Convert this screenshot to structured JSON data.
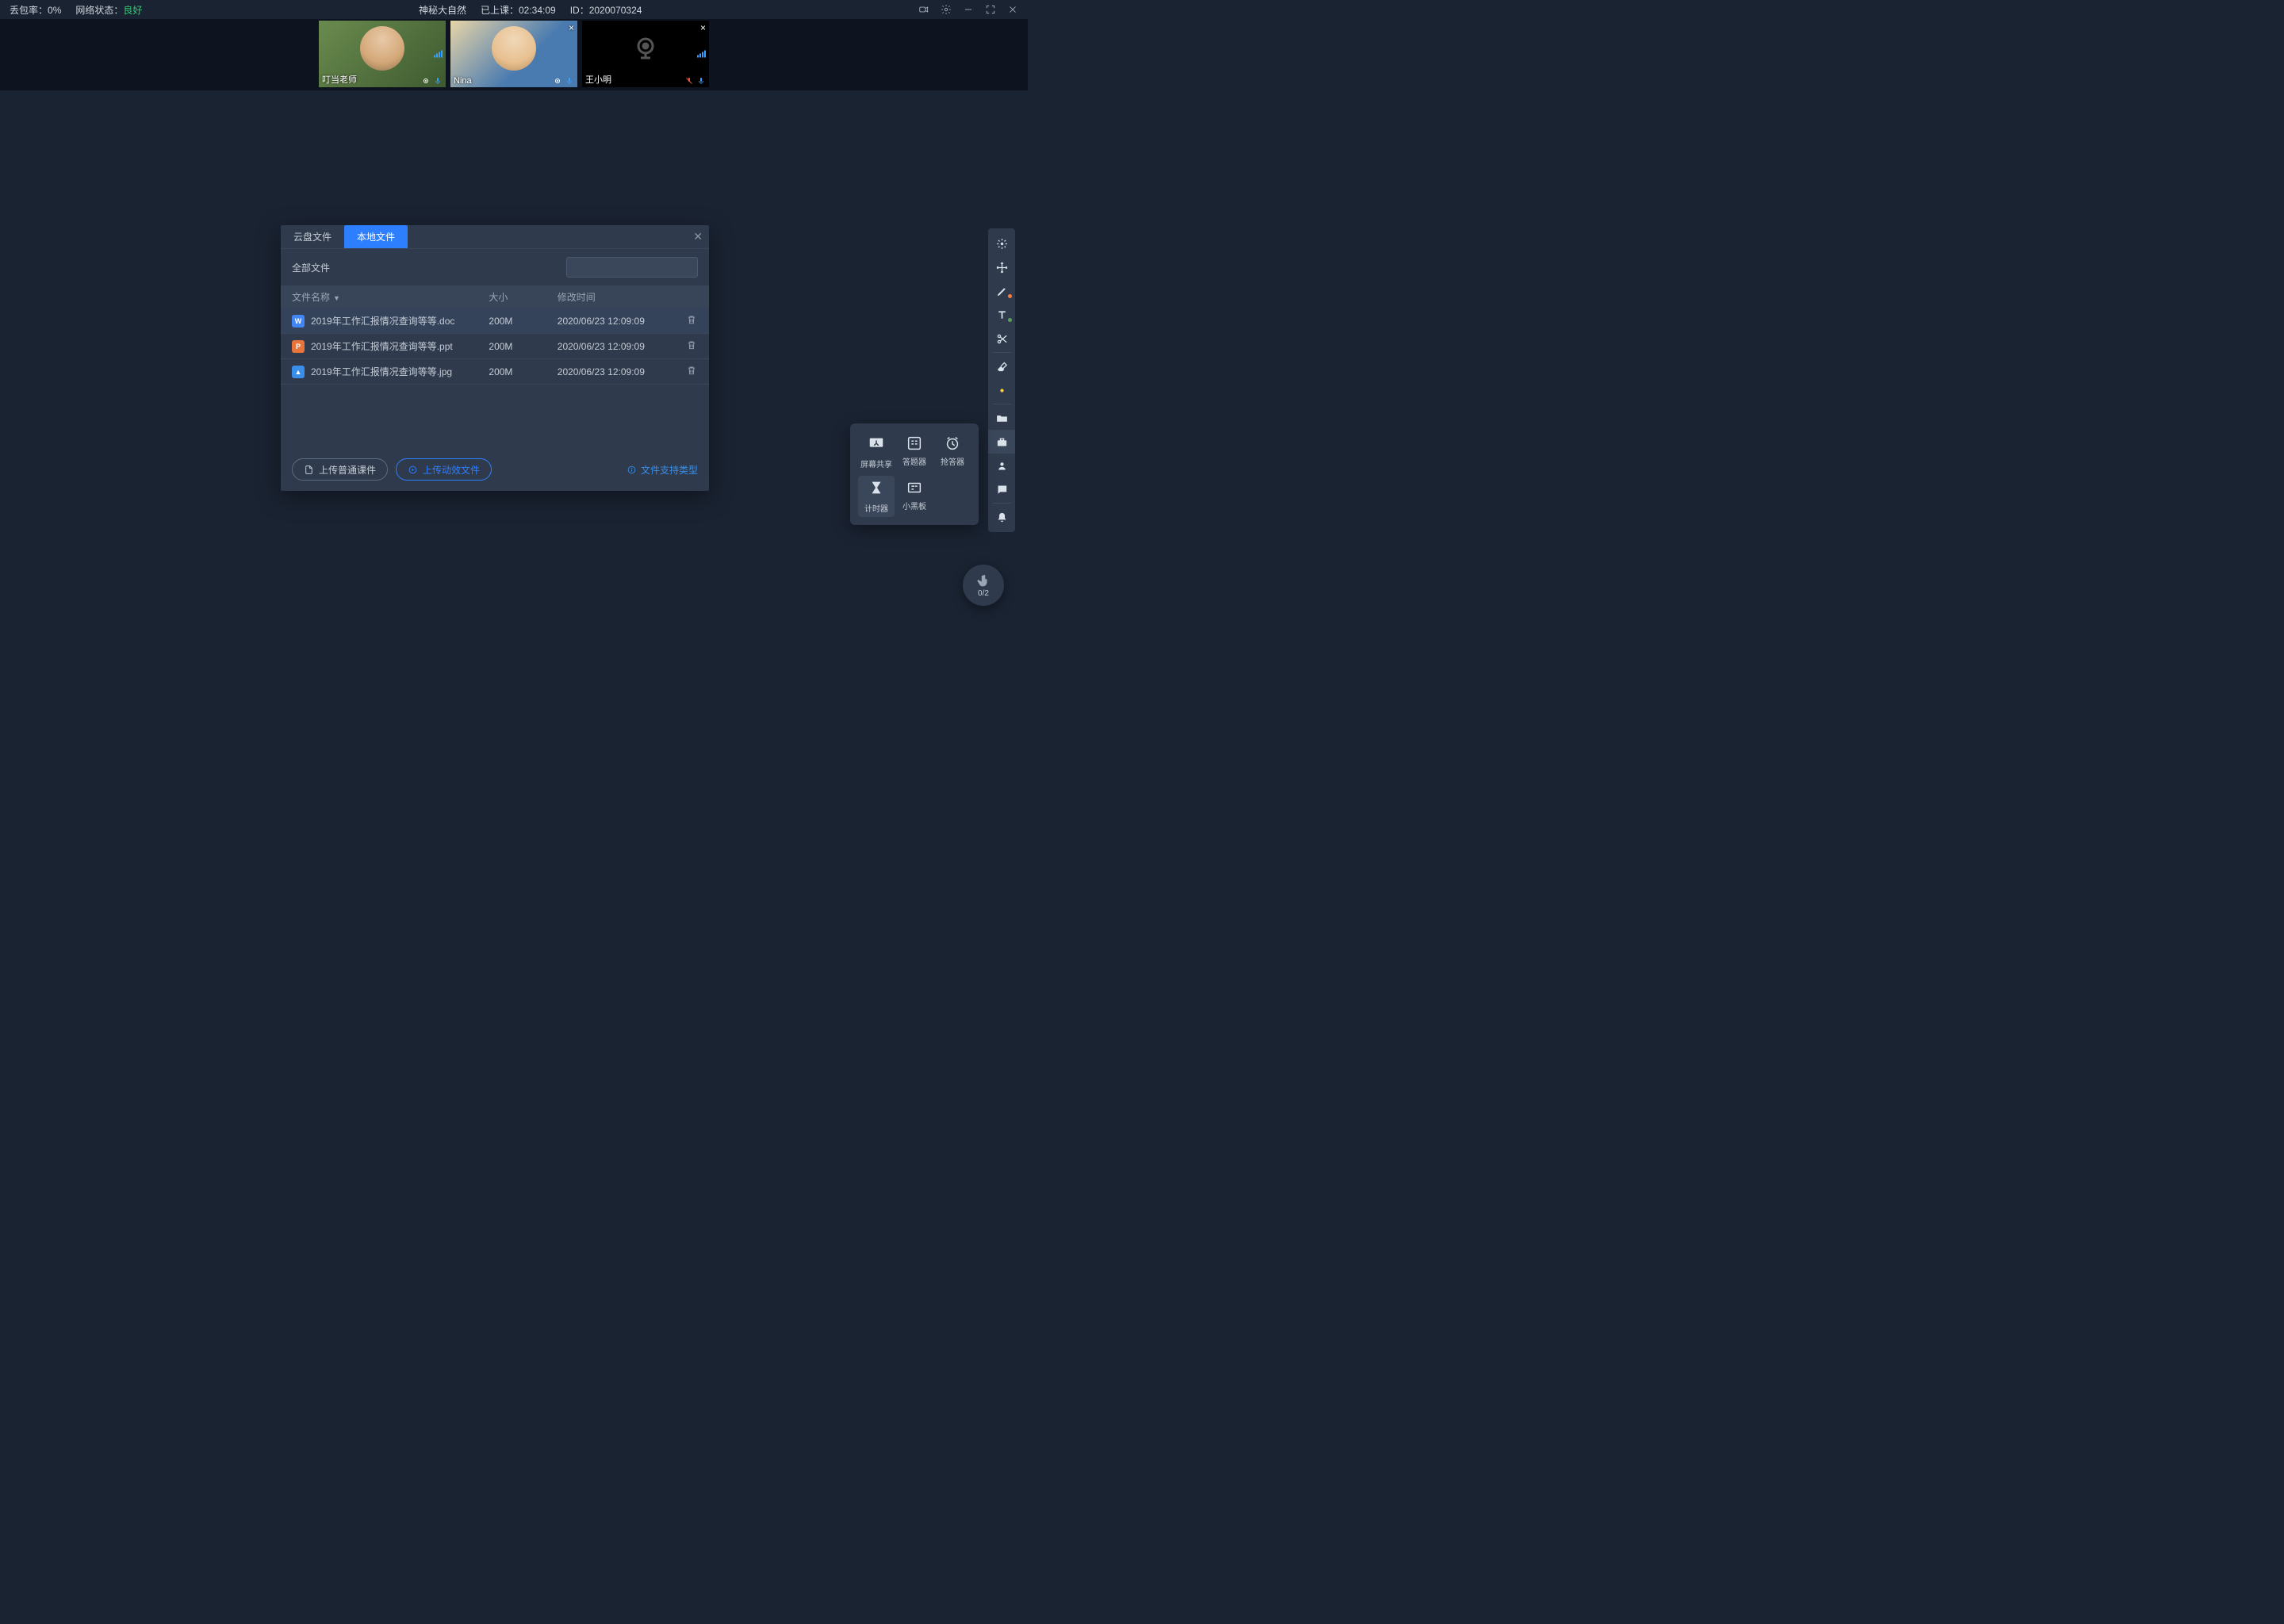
{
  "topbar": {
    "loss_label": "丢包率：",
    "loss_value": "0%",
    "net_label": "网络状态：",
    "net_value": "良好",
    "room_name": "神秘大自然",
    "elapsed_label": "已上课：",
    "elapsed_value": "02:34:09",
    "id_label": "ID：",
    "id_value": "2020070324"
  },
  "videos": [
    {
      "name": "叮当老师",
      "muted": false,
      "cam_on": true
    },
    {
      "name": "Nina",
      "muted": false,
      "cam_on": true
    },
    {
      "name": "王小明",
      "muted": true,
      "cam_on": false
    }
  ],
  "dialog": {
    "tabs": {
      "cloud": "云盘文件",
      "local": "本地文件"
    },
    "breadcrumb": "全部文件",
    "search_placeholder": "",
    "cols": {
      "name": "文件名称",
      "size": "大小",
      "modified": "修改时间"
    },
    "files": [
      {
        "icon": "W",
        "cls": "word",
        "name": "2019年工作汇报情况查询等等.doc",
        "size": "200M",
        "modified": "2020/06/23 12:09:09"
      },
      {
        "icon": "P",
        "cls": "ppt",
        "name": "2019年工作汇报情况查询等等.ppt",
        "size": "200M",
        "modified": "2020/06/23 12:09:09"
      },
      {
        "icon": "▲",
        "cls": "img",
        "name": "2019年工作汇报情况查询等等.jpg",
        "size": "200M",
        "modified": "2020/06/23 12:09:09"
      }
    ],
    "upload_normal": "上传普通课件",
    "upload_motion": "上传动效文件",
    "hint": "文件支持类型"
  },
  "toolpop": {
    "screen_share": "屏幕共享",
    "quiz": "答题器",
    "buzzer": "抢答器",
    "timer": "计时器",
    "miniboard": "小黑板"
  },
  "handraise": {
    "count": "0/2"
  }
}
